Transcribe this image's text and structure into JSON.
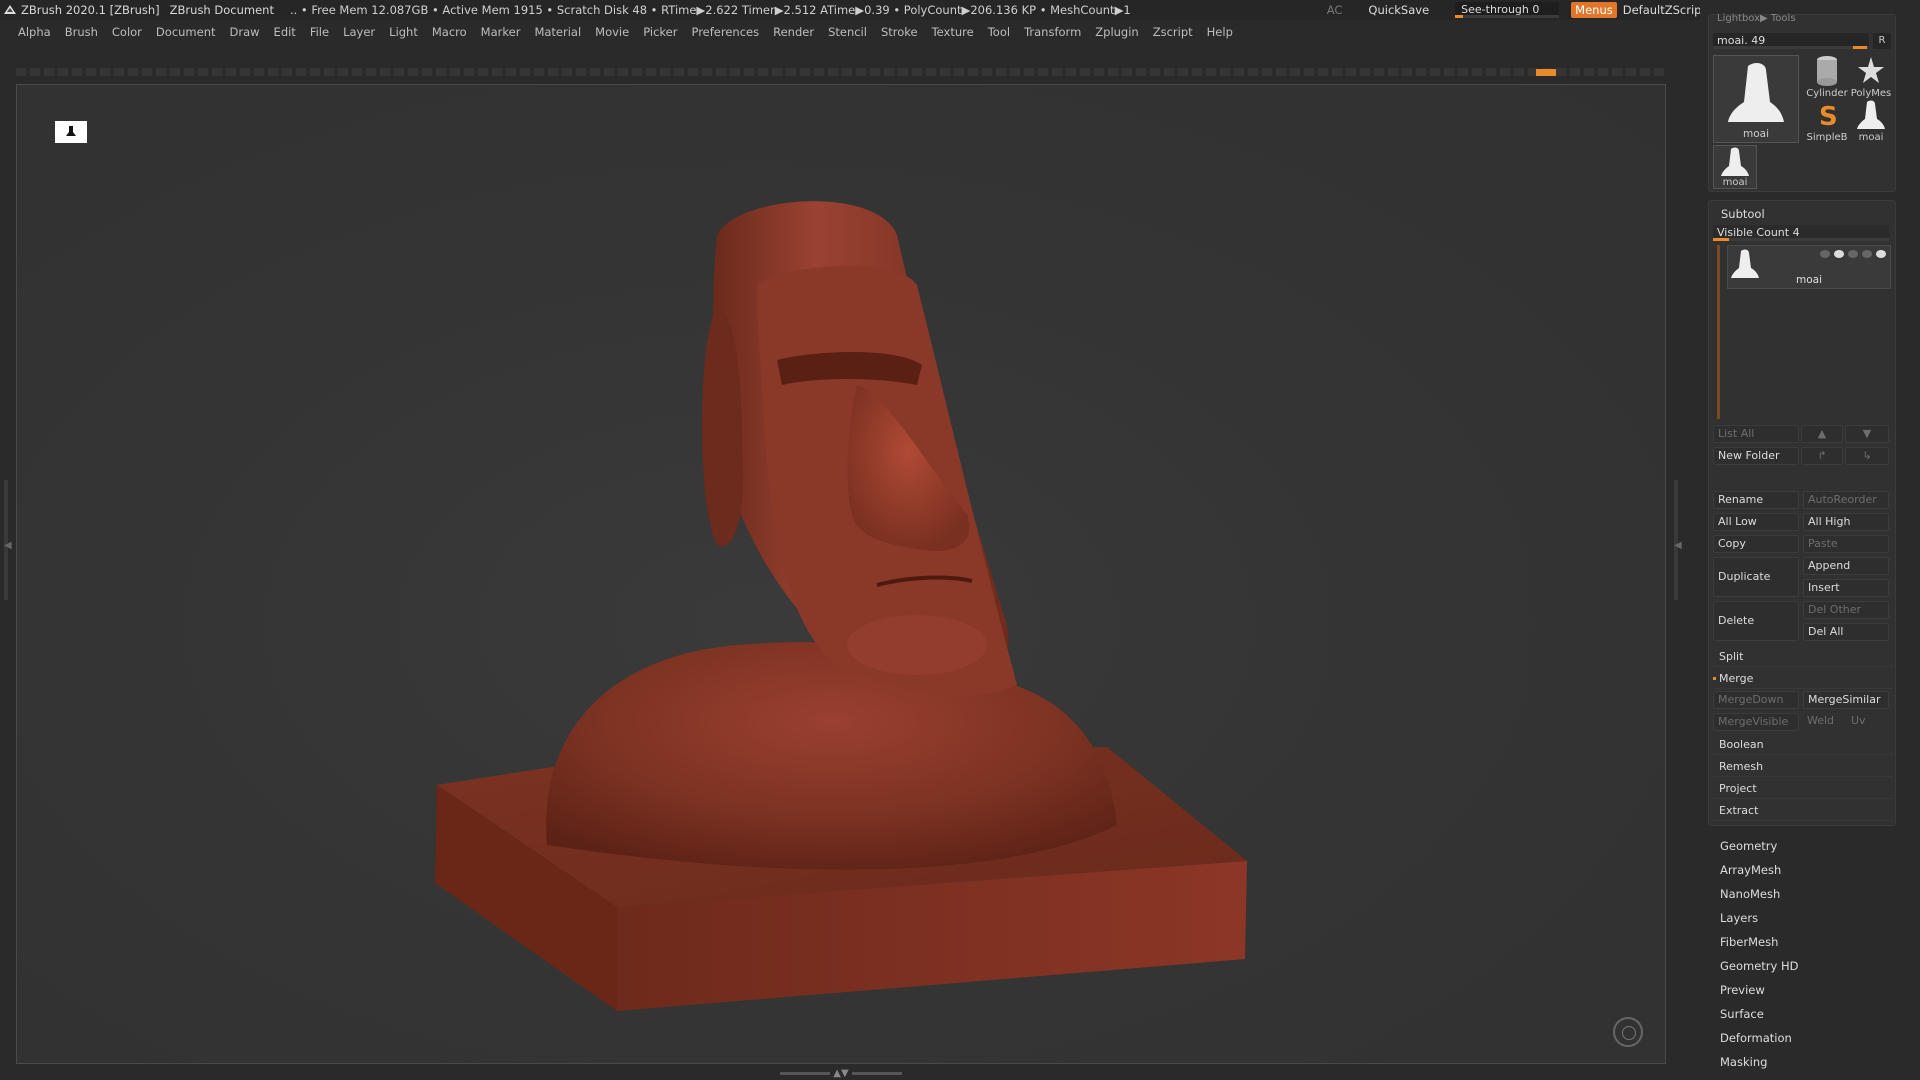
{
  "titlebar": {
    "app": "ZBrush 2020.1 [ZBrush]",
    "document": "ZBrush Document",
    "stats": ".. • Free Mem 12.087GB • Active Mem 1915 • Scratch Disk 48 • RTime▶2.622 Timer▶2.512 ATime▶0.39 • PolyCount▶206.136 KP • MeshCount▶1",
    "ac": "AC",
    "quicksave": "QuickSave",
    "see_through_label": "See-through  0",
    "menus": "Menus",
    "zscript": "DefaultZScript",
    "accent": "#e98b2a"
  },
  "menubar": [
    "Alpha",
    "Brush",
    "Color",
    "Document",
    "Draw",
    "Edit",
    "File",
    "Layer",
    "Light",
    "Macro",
    "Marker",
    "Material",
    "Movie",
    "Picker",
    "Preferences",
    "Render",
    "Stencil",
    "Stroke",
    "Texture",
    "Tool",
    "Transform",
    "Zplugin",
    "Zscript",
    "Help"
  ],
  "tool": {
    "lightbox_label": "Lightbox▶ Tools",
    "slider_label": "moai. 49",
    "r_label": "R",
    "main_thumb": "moai",
    "thumbs": [
      "Cylinder",
      "PolyMes",
      "SimpleB",
      "moai",
      "moai"
    ]
  },
  "subtool": {
    "title": "Subtool",
    "visible_count": "Visible Count 4",
    "item_name": "moai",
    "list_all": "List All",
    "new_folder": "New Folder",
    "rename": "Rename",
    "autoreorder": "AutoReorder",
    "all_low": "All Low",
    "all_high": "All High",
    "copy": "Copy",
    "paste": "Paste",
    "duplicate": "Duplicate",
    "append": "Append",
    "insert": "Insert",
    "delete": "Delete",
    "del_other": "Del Other",
    "del_all": "Del All",
    "split": "Split",
    "merge": "Merge",
    "mergedown": "MergeDown",
    "mergesimilar": "MergeSimilar",
    "mergevisible": "MergeVisible",
    "weld": "Weld",
    "uv": "Uv",
    "boolean": "Boolean",
    "remesh": "Remesh",
    "project": "Project",
    "extract": "Extract"
  },
  "sections": [
    "Geometry",
    "ArrayMesh",
    "NanoMesh",
    "Layers",
    "FiberMesh",
    "Geometry HD",
    "Preview",
    "Surface",
    "Deformation",
    "Masking"
  ],
  "model": {
    "color": "#8a3826",
    "name": "moai"
  }
}
